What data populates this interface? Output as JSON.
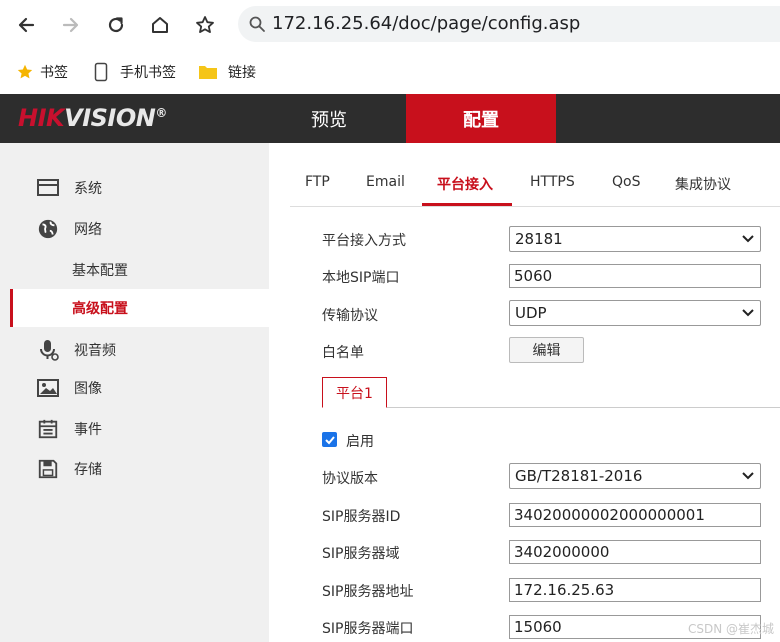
{
  "browser": {
    "url": "172.16.25.64/doc/page/config.asp",
    "bookmarks": [
      {
        "label": "书签",
        "icon": "star-icon"
      },
      {
        "label": "手机书签",
        "icon": "phone-icon"
      },
      {
        "label": "链接",
        "icon": "folder-icon"
      }
    ]
  },
  "header": {
    "logo_main": "HIKVISION",
    "logo_mark": "®",
    "nav": [
      {
        "label": "预览",
        "active": false
      },
      {
        "label": "配置",
        "active": true
      }
    ]
  },
  "sidebar": {
    "items": [
      {
        "label": "系统",
        "icon": "monitor-icon"
      },
      {
        "label": "网络",
        "icon": "globe-icon"
      },
      {
        "label": "基本配置",
        "sub": true
      },
      {
        "label": "高级配置",
        "sub": true,
        "active": true
      },
      {
        "label": "视音频",
        "icon": "microphone-icon"
      },
      {
        "label": "图像",
        "icon": "image-icon"
      },
      {
        "label": "事件",
        "icon": "calendar-icon"
      },
      {
        "label": "存储",
        "icon": "save-icon"
      }
    ]
  },
  "tabs": [
    {
      "label": "FTP"
    },
    {
      "label": "Email"
    },
    {
      "label": "平台接入",
      "active": true
    },
    {
      "label": "HTTPS"
    },
    {
      "label": "QoS"
    },
    {
      "label": "集成协议"
    }
  ],
  "form": {
    "access_mode_label": "平台接入方式",
    "access_mode_value": "28181",
    "sip_port_label": "本地SIP端口",
    "sip_port_value": "5060",
    "transport_label": "传输协议",
    "transport_value": "UDP",
    "whitelist_label": "白名单",
    "edit_button": "编辑",
    "platform_tab": "平台1",
    "enable_label": "启用",
    "enable_checked": true,
    "protocol_version_label": "协议版本",
    "protocol_version_value": "GB/T28181-2016",
    "sip_server_id_label": "SIP服务器ID",
    "sip_server_id_value": "34020000002000000001",
    "sip_domain_label": "SIP服务器域",
    "sip_domain_value": "3402000000",
    "sip_address_label": "SIP服务器地址",
    "sip_address_value": "172.16.25.63",
    "sip_server_port_label": "SIP服务器端口",
    "sip_server_port_value": "15060"
  },
  "watermark": "CSDN @崔杰城",
  "colors": {
    "accent": "#c8101c",
    "header_bg": "#2d2d2d",
    "sidebar_bg": "#f0f0f0",
    "checkbox": "#1a73e8"
  }
}
